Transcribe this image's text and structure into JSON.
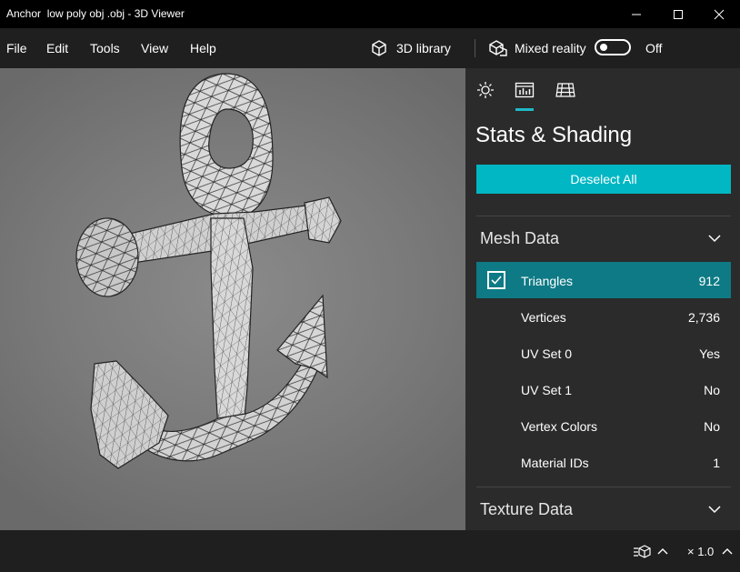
{
  "window": {
    "title": "Anchor  low poly obj .obj - 3D Viewer"
  },
  "menu": {
    "items": [
      "File",
      "Edit",
      "Tools",
      "View",
      "Help"
    ]
  },
  "toolbar": {
    "library_label": "3D library",
    "mixed_reality_label": "Mixed reality",
    "toggle_state": "Off"
  },
  "panel": {
    "tabs": [
      "Lighting",
      "Stats & Shading",
      "Grid"
    ],
    "title": "Stats & Shading",
    "deselect_label": "Deselect All",
    "mesh_section": "Mesh Data",
    "rows": [
      {
        "label": "Triangles",
        "value": "912",
        "checked": true
      },
      {
        "label": "Vertices",
        "value": "2,736"
      },
      {
        "label": "UV Set 0",
        "value": "Yes"
      },
      {
        "label": "UV Set 1",
        "value": "No"
      },
      {
        "label": "Vertex Colors",
        "value": "No"
      },
      {
        "label": "Material IDs",
        "value": "1"
      }
    ],
    "texture_section": "Texture Data"
  },
  "status": {
    "zoom": "× 1.0"
  },
  "colors": {
    "accent": "#00b7c3",
    "selected_row": "#0e7a85",
    "panel_bg": "#2b2b2b",
    "titlebar_bg": "#000000"
  },
  "icons": [
    "3d-library-icon",
    "mixed-reality-icon",
    "sun-icon",
    "stats-icon",
    "grid-icon",
    "chevron-down-icon",
    "checkmark-icon",
    "chevron-up-icon"
  ]
}
